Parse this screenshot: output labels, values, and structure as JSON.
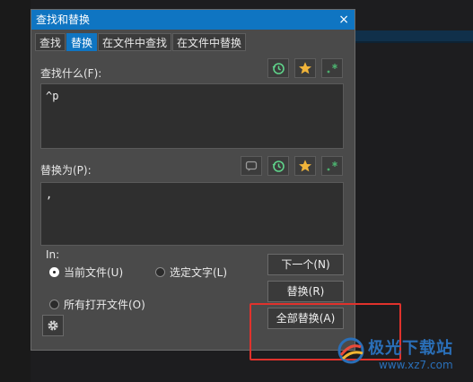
{
  "dialog": {
    "title": "查找和替换",
    "close_glyph": "×"
  },
  "tabs": [
    {
      "label": "查找",
      "active": false
    },
    {
      "label": "替换",
      "active": true
    },
    {
      "label": "在文件中查找",
      "active": false
    },
    {
      "label": "在文件中替换",
      "active": false
    }
  ],
  "find": {
    "label": "查找什么(F):",
    "value": "^p"
  },
  "replace": {
    "label": "替换为(P):",
    "value": ","
  },
  "scope": {
    "label": "In:",
    "options": [
      {
        "label": "当前文件(U)",
        "selected": true
      },
      {
        "label": "选定文字(L)",
        "selected": false
      },
      {
        "label": "所有打开文件(O)",
        "selected": false
      }
    ]
  },
  "buttons": {
    "next": "下一个(N)",
    "replace": "替换(R)",
    "replace_all": "全部替换(A)"
  },
  "watermark": {
    "title": "极光下载站",
    "url": "www.xz7.com"
  },
  "colors": {
    "accent": "#0f75c2",
    "highlight": "#e0322c",
    "star": "#f0b43a",
    "history": "#5fd38a"
  }
}
